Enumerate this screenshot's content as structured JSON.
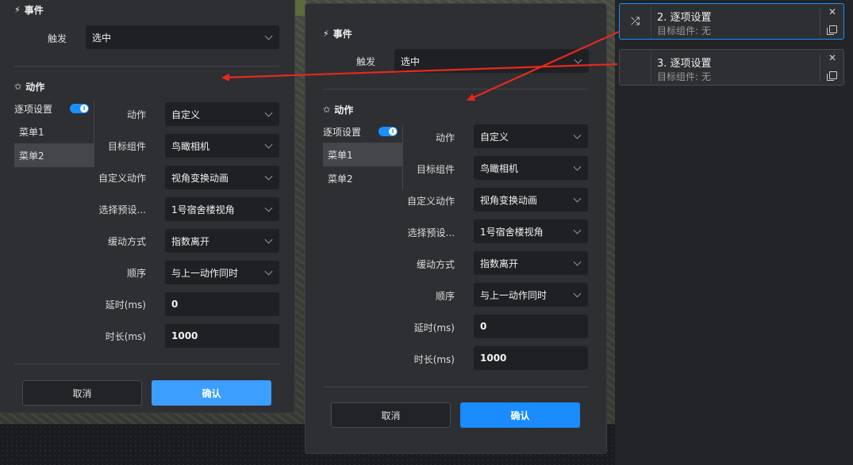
{
  "event": {
    "title": "事件",
    "trigger_label": "触发",
    "trigger_value": "选中"
  },
  "action": {
    "title": "动作",
    "tab_header": "逐项设置",
    "tabs": [
      "菜单1",
      "菜单2"
    ],
    "fields": {
      "action_label": "动作",
      "action_value": "自定义",
      "target_label": "目标组件",
      "target_value": "鸟瞰相机",
      "custom_action_label": "自定义动作",
      "custom_action_value": "视角变换动画",
      "preset_label": "选择预设...",
      "preset_value": "1号宿舍楼视角",
      "easing_label": "缓动方式",
      "easing_value": "指数离开",
      "order_label": "顺序",
      "order_value": "与上一动作同时",
      "delay_label": "延时(ms)",
      "delay_value": "0",
      "duration_label": "时长(ms)",
      "duration_value": "1000"
    }
  },
  "buttons": {
    "cancel": "取消",
    "ok": "确认"
  },
  "cards": [
    {
      "title": "2. 逐项设置",
      "subtitle": "目标组件: 无",
      "icon": "shuffle-icon"
    },
    {
      "title": "3. 逐项设置",
      "subtitle": "目标组件: 无",
      "icon": ""
    }
  ],
  "colors": {
    "accent": "#1890ff",
    "arrow": "#e8281e",
    "panel": "#2e2f33"
  }
}
